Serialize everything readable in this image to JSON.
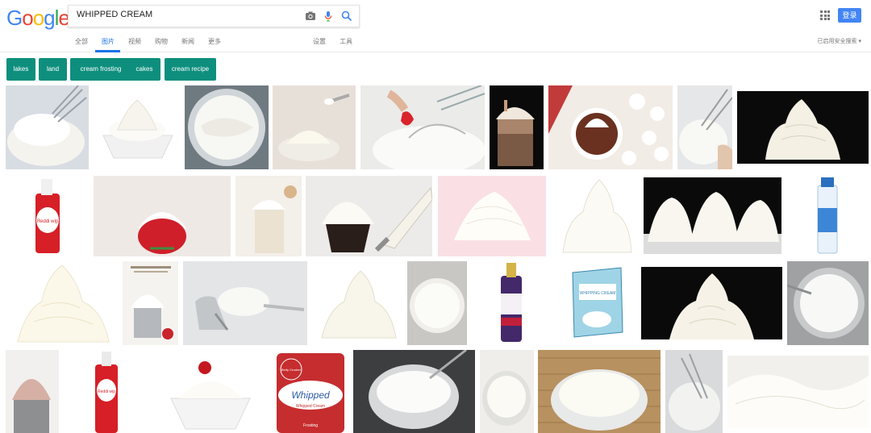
{
  "logo": {
    "letters": [
      "G",
      "o",
      "o",
      "g",
      "l",
      "e"
    ],
    "colors": [
      "#4285f4",
      "#ea4335",
      "#fbbc05",
      "#4285f4",
      "#34a853",
      "#ea4335"
    ]
  },
  "search": {
    "value": "WHIPPED CREAM"
  },
  "header": {
    "login_label": "登录"
  },
  "tabs": [
    {
      "label": "全部"
    },
    {
      "label": "图片"
    },
    {
      "label": "视频"
    },
    {
      "label": "购物"
    },
    {
      "label": "新闻"
    },
    {
      "label": "更多"
    },
    {
      "label": "设置"
    },
    {
      "label": "工具"
    }
  ],
  "safesearch": "已启用安全搜索 ▾",
  "chips": [
    {
      "label": "lakes"
    },
    {
      "label": "land"
    },
    {
      "label": "cream frosting"
    },
    {
      "label": "cakes"
    },
    {
      "label": "cream recipe"
    }
  ],
  "colors": {
    "accent": "#1a73e8",
    "chip": "#0e8f7e",
    "login": "#4285f4"
  },
  "thumb_texts": {
    "reddi_wip": "Reddi wip",
    "whipped_can": "Whipped",
    "whipped_sub": "Whipped Cream",
    "frosting": "Frosting",
    "betty": "Betty Crocker",
    "powder_box": "WHIPPING CREAM"
  }
}
